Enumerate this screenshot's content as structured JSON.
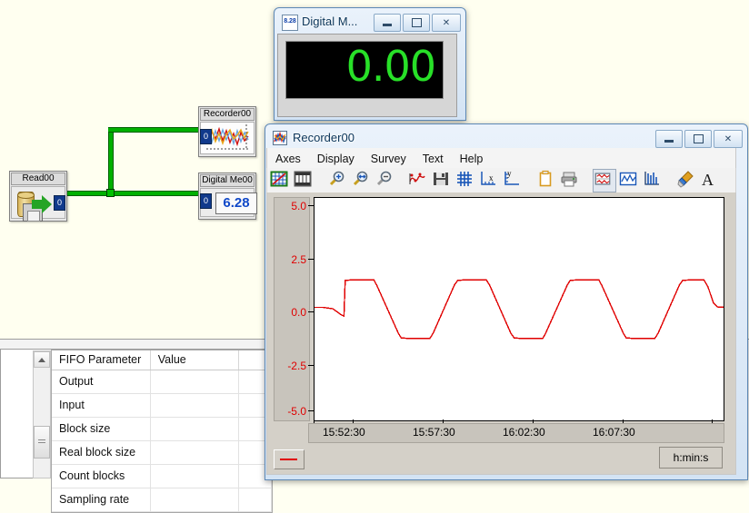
{
  "workspace": {
    "background_color": "#fffff0",
    "blocks": [
      {
        "id": "read00",
        "title": "Read00",
        "port": "0",
        "icon": "database-floppy-arrow-icon"
      },
      {
        "id": "recorder00",
        "title": "Recorder00",
        "port": "0",
        "icon": "waveform-chart-icon"
      },
      {
        "id": "digitalme00",
        "title": "Digital Me00",
        "port": "0",
        "icon": "digital-display-icon",
        "value": "6.28"
      }
    ],
    "wire_color": "#00b000"
  },
  "fifo_panel": {
    "columns": [
      "FIFO Parameter",
      "Value",
      ""
    ],
    "rows": [
      {
        "parameter": "Output",
        "value": ""
      },
      {
        "parameter": "Input",
        "value": ""
      },
      {
        "parameter": "Block size",
        "value": ""
      },
      {
        "parameter": "Real block size",
        "value": ""
      },
      {
        "parameter": "Count blocks",
        "value": ""
      },
      {
        "parameter": "Sampling rate",
        "value": ""
      }
    ]
  },
  "digital_meter_window": {
    "title": "Digital M...",
    "icon": "digital-meter-icon",
    "icon_text": "8.28",
    "value": "0.00",
    "value_color": "#28e028",
    "buttons": {
      "minimize": "Minimize",
      "maximize": "Maximize",
      "close": "Close"
    }
  },
  "recorder_window": {
    "title": "Recorder00",
    "icon": "recorder-chart-icon",
    "buttons": {
      "minimize": "Minimize",
      "maximize": "Maximize",
      "close": "Close"
    },
    "menu": [
      "Axes",
      "Display",
      "Survey",
      "Text",
      "Help"
    ],
    "toolbar": [
      {
        "name": "show-grid-axes-icon",
        "tip": "Axes"
      },
      {
        "name": "film-strip-icon",
        "tip": "Frames"
      },
      {
        "name": "zoom-in-icon",
        "tip": "Zoom in"
      },
      {
        "name": "zoom-fit-icon",
        "tip": "Zoom fit"
      },
      {
        "name": "zoom-out-icon",
        "tip": "Zoom out"
      },
      {
        "name": "curve-points-icon",
        "tip": "Curve"
      },
      {
        "name": "save-icon",
        "tip": "Save"
      },
      {
        "name": "grid-icon",
        "tip": "Grid"
      },
      {
        "name": "x-axis-icon",
        "tip": "X axis"
      },
      {
        "name": "y-axis-icon",
        "tip": "Y axis"
      },
      {
        "name": "clipboard-icon",
        "tip": "Copy"
      },
      {
        "name": "print-icon",
        "tip": "Print"
      },
      {
        "name": "multi-trace-icon",
        "tip": "Multi trace"
      },
      {
        "name": "single-trace-icon",
        "tip": "Single trace"
      },
      {
        "name": "bar-trace-icon",
        "tip": "Bars"
      },
      {
        "name": "paint-brush-icon",
        "tip": "Colors"
      },
      {
        "name": "text-format-icon",
        "tip": "Text"
      }
    ],
    "unit_label": "h:min:s",
    "legend_color": "#e00000"
  },
  "chart_data": {
    "type": "line",
    "title": "",
    "xlabel": "h:min:s",
    "ylabel": "",
    "ylim": [
      -6.0,
      6.0
    ],
    "yticks": [
      5.0,
      2.5,
      0.0,
      -2.5,
      -5.0
    ],
    "ytick_labels": [
      "5.0",
      "2.5",
      "0.0",
      "-2.5",
      "-5.0"
    ],
    "xtick_labels": [
      "15:52:30",
      "15:57:30",
      "16:02:30",
      "16:07:30"
    ],
    "xtick_positions_frac": [
      0.095,
      0.315,
      0.535,
      0.755
    ],
    "grid": false,
    "legend_position": "bottom-left",
    "series": [
      {
        "name": "trace-1",
        "color": "#e00000",
        "comment": "clipped (trapezoidal) periodic waveform, x in fraction of plot width, y in data units",
        "points": [
          [
            0.0,
            0.1
          ],
          [
            0.02,
            0.1
          ],
          [
            0.045,
            0.02
          ],
          [
            0.065,
            -0.3
          ],
          [
            0.072,
            -0.38
          ],
          [
            0.075,
            1.55
          ],
          [
            0.092,
            1.58
          ],
          [
            0.145,
            1.58
          ],
          [
            0.152,
            1.3
          ],
          [
            0.205,
            -1.3
          ],
          [
            0.212,
            -1.55
          ],
          [
            0.23,
            -1.58
          ],
          [
            0.282,
            -1.58
          ],
          [
            0.29,
            -1.3
          ],
          [
            0.342,
            1.3
          ],
          [
            0.35,
            1.55
          ],
          [
            0.368,
            1.58
          ],
          [
            0.42,
            1.58
          ],
          [
            0.428,
            1.3
          ],
          [
            0.48,
            -1.3
          ],
          [
            0.488,
            -1.55
          ],
          [
            0.505,
            -1.58
          ],
          [
            0.558,
            -1.58
          ],
          [
            0.565,
            -1.3
          ],
          [
            0.618,
            1.3
          ],
          [
            0.625,
            1.55
          ],
          [
            0.643,
            1.58
          ],
          [
            0.695,
            1.58
          ],
          [
            0.702,
            1.3
          ],
          [
            0.755,
            -1.3
          ],
          [
            0.762,
            -1.55
          ],
          [
            0.78,
            -1.58
          ],
          [
            0.832,
            -1.58
          ],
          [
            0.84,
            -1.3
          ],
          [
            0.892,
            1.3
          ],
          [
            0.9,
            1.55
          ],
          [
            0.918,
            1.58
          ],
          [
            0.952,
            1.58
          ],
          [
            0.962,
            1.2
          ],
          [
            0.975,
            0.35
          ],
          [
            0.985,
            0.12
          ],
          [
            1.0,
            0.1
          ]
        ]
      }
    ]
  }
}
